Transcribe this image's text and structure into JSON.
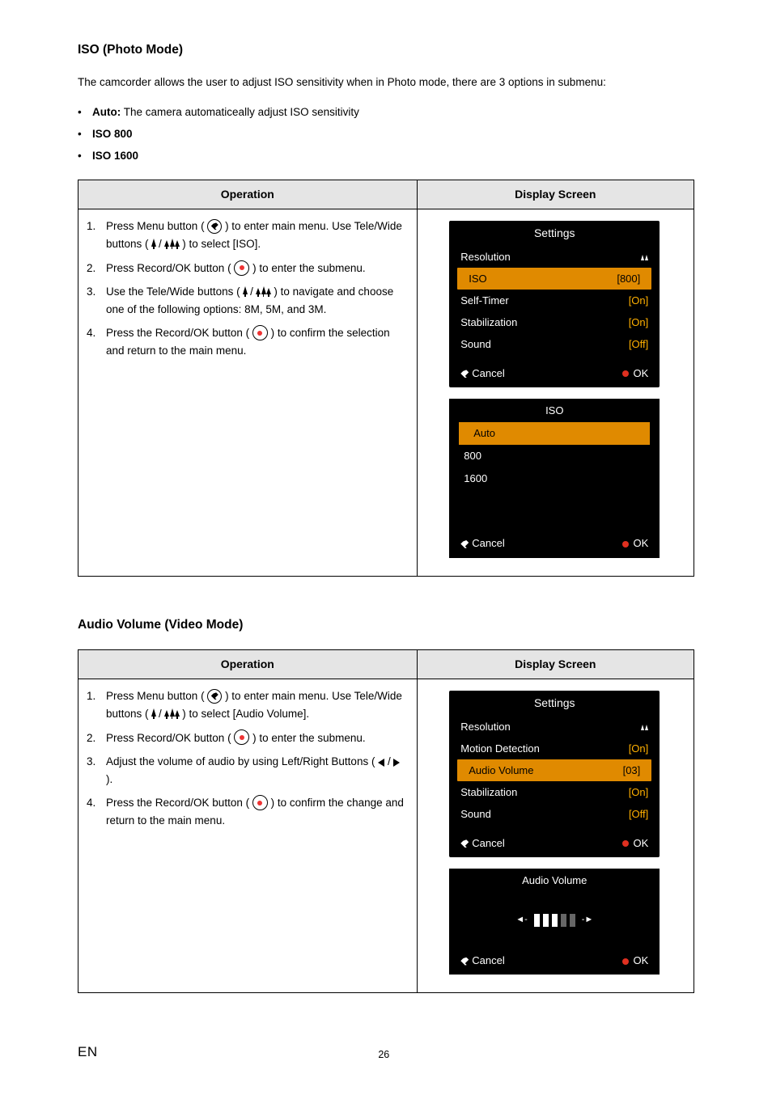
{
  "section1": {
    "title": "ISO (Photo Mode)",
    "intro": "The camcorder allows the user to adjust ISO sensitivity when in Photo mode, there are 3 options in submenu:",
    "bullets": [
      {
        "label": "Auto:",
        "text": " The camera automaticeally adjust ISO sensitivity"
      },
      {
        "label": "ISO 800",
        "text": ""
      },
      {
        "label": "ISO 1600",
        "text": ""
      }
    ],
    "table": {
      "head_op": "Operation",
      "head_ds": "Display Screen",
      "steps": {
        "s1a": "Press Menu button ( ",
        "s1b": " ) to enter main menu. Use Tele/Wide buttons ( ",
        "s1c": " ) to select [ISO].",
        "s2a": "Press Record/OK button ( ",
        "s2b": " ) to enter the submenu.",
        "s3a": "Use the Tele/Wide buttons ( ",
        "s3b": " ) to navigate and choose one of the following options: 8M, 5M, and 3M.",
        "s4a": "Press the Record/OK button ( ",
        "s4b": " ) to confirm the selection and return to the main menu."
      }
    },
    "screen1": {
      "title": "Settings",
      "rows": [
        {
          "label": "Resolution",
          "value_icon": true
        },
        {
          "label": "ISO",
          "value": "[800]",
          "highlight": true
        },
        {
          "label": "Self-Timer",
          "value": "[On]"
        },
        {
          "label": "Stabilization",
          "value": "[On]"
        },
        {
          "label": "Sound",
          "value": "[Off]"
        }
      ],
      "cancel": "Cancel",
      "ok": "OK"
    },
    "screen2": {
      "title": "ISO",
      "options": [
        {
          "label": "Auto",
          "highlight": true
        },
        {
          "label": "800"
        },
        {
          "label": "1600"
        }
      ],
      "cancel": "Cancel",
      "ok": "OK"
    }
  },
  "section2": {
    "title": "Audio Volume (Video Mode)",
    "table": {
      "head_op": "Operation",
      "head_ds": "Display Screen",
      "steps": {
        "s1a": "Press Menu button ( ",
        "s1b": " ) to enter main menu. Use Tele/Wide buttons ( ",
        "s1c": " ) to select [Audio Volume].",
        "s2a": "Press Record/OK button ( ",
        "s2b": " ) to enter the submenu.",
        "s3a": "Adjust the volume  of audio by using Left/Right Buttons ( ",
        "s3b": " ).",
        "s4a": "Press the Record/OK button ( ",
        "s4b": " ) to confirm the change and return to the main menu."
      }
    },
    "screen1": {
      "title": "Settings",
      "rows": [
        {
          "label": "Resolution",
          "value_icon": true
        },
        {
          "label": "Motion Detection",
          "value": "[On]"
        },
        {
          "label": "Audio Volume",
          "value": "[03]",
          "highlight": true
        },
        {
          "label": "Stabilization",
          "value": "[On]"
        },
        {
          "label": "Sound",
          "value": "[Off]"
        }
      ],
      "cancel": "Cancel",
      "ok": "OK"
    },
    "screen2": {
      "title": "Audio Volume",
      "cancel": "Cancel",
      "ok": "OK"
    }
  },
  "footer": {
    "en": "EN",
    "page": "26"
  },
  "chart_data": {
    "type": "table",
    "note": "Two documentation tables each with Operation steps (left) and on-device Display Screen mockups (right). Display screens show camera Settings menus.",
    "iso_settings_screen": {
      "title": "Settings",
      "items": [
        {
          "label": "Resolution",
          "value": "(tree icon)"
        },
        {
          "label": "ISO",
          "value": "[800]",
          "selected": true
        },
        {
          "label": "Self-Timer",
          "value": "[On]"
        },
        {
          "label": "Stabilization",
          "value": "[On]"
        },
        {
          "label": "Sound",
          "value": "[Off]"
        }
      ],
      "footer": [
        "Cancel",
        "OK"
      ]
    },
    "iso_submenu_screen": {
      "title": "ISO",
      "options": [
        "Auto",
        "800",
        "1600"
      ],
      "selected": "Auto",
      "footer": [
        "Cancel",
        "OK"
      ]
    },
    "audio_settings_screen": {
      "title": "Settings",
      "items": [
        {
          "label": "Resolution",
          "value": "(tree icon)"
        },
        {
          "label": "Motion Detection",
          "value": "[On]"
        },
        {
          "label": "Audio Volume",
          "value": "[03]",
          "selected": true
        },
        {
          "label": "Stabilization",
          "value": "[On]"
        },
        {
          "label": "Sound",
          "value": "[Off]"
        }
      ],
      "footer": [
        "Cancel",
        "OK"
      ]
    },
    "audio_volume_screen": {
      "title": "Audio Volume",
      "level": 3,
      "max": 5,
      "footer": [
        "Cancel",
        "OK"
      ]
    }
  }
}
